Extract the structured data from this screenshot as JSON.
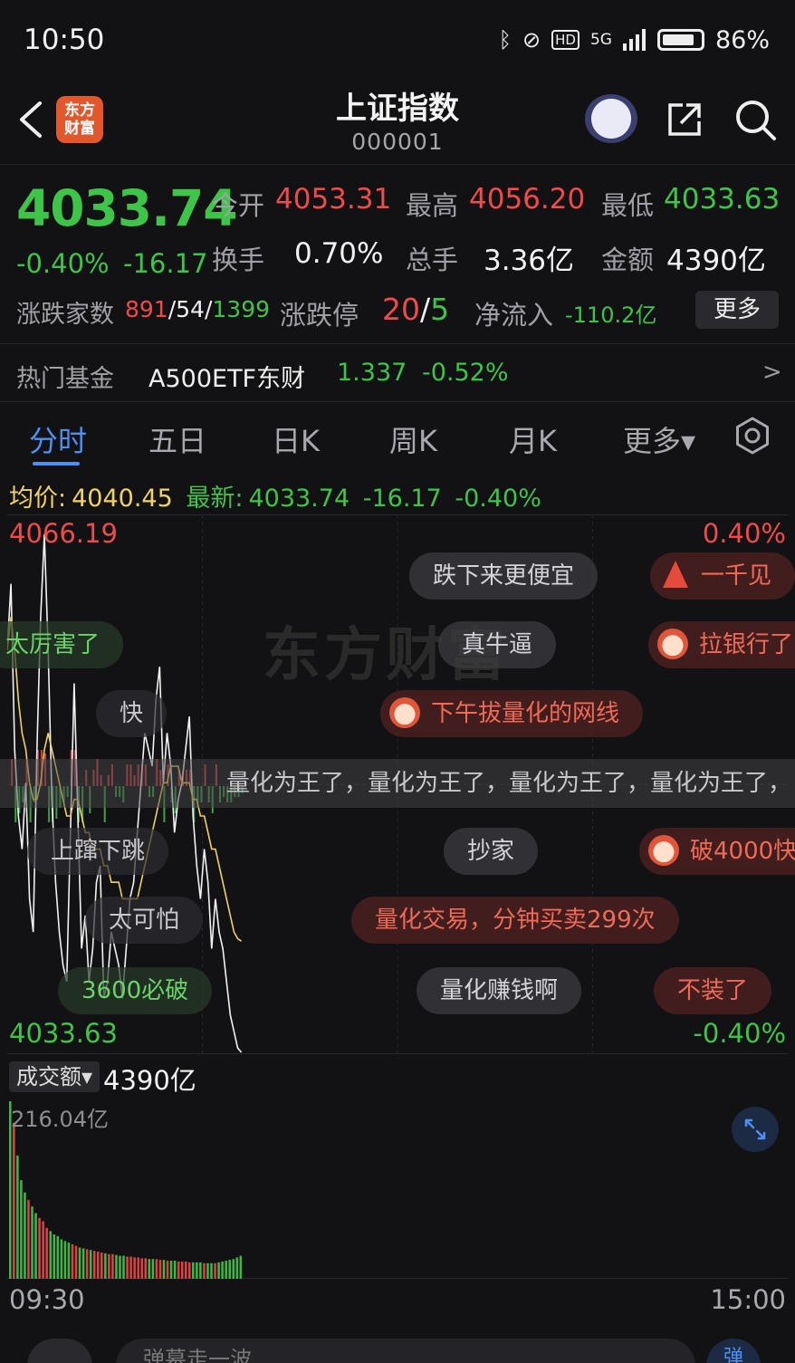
{
  "status_bar": {
    "time": "10:50",
    "battery": "86%",
    "battery_level": 0.86,
    "network": "5G",
    "hd": "HD"
  },
  "header": {
    "title": "上证指数",
    "code": "000001",
    "logo_text_line1": "东方",
    "logo_text_line2": "财富"
  },
  "quote": {
    "price": "4033.74",
    "change_pct": "-0.40%",
    "change_abs": "-16.17",
    "open_label": "今开",
    "open": "4053.31",
    "high_label": "最高",
    "high": "4056.20",
    "low_label": "最低",
    "low": "4033.63",
    "turnover_label": "换手",
    "turnover": "0.70%",
    "volume_label": "总手",
    "volume": "3.36亿",
    "amount_label": "金额",
    "amount": "4390亿",
    "breadth_label": "涨跌家数",
    "breadth_up": "891",
    "breadth_flat": "54",
    "breadth_down": "1399",
    "limit_label": "涨跌停",
    "limit_up": "20",
    "limit_down": "5",
    "netflow_label": "净流入",
    "netflow": "-110.2亿",
    "more_label": "更多"
  },
  "fund": {
    "label": "热门基金",
    "name": "A500ETF东财",
    "price": "1.337",
    "change": "-0.52%",
    "arrow": ">"
  },
  "tabs": [
    {
      "label": "分时",
      "active": true
    },
    {
      "label": "五日"
    },
    {
      "label": "日K"
    },
    {
      "label": "周K"
    },
    {
      "label": "月K"
    },
    {
      "label": "更多▾"
    }
  ],
  "summary": {
    "avg_label": "均价:",
    "avg": "4040.45",
    "latest_label": "最新:",
    "latest": "4033.74",
    "chg": "-16.17",
    "pct": "-0.40%"
  },
  "chart_axes": {
    "high": "4066.19",
    "low": "4033.63",
    "pct_high": "0.40%",
    "pct_low": "-0.40%"
  },
  "watermark": "东方财富",
  "danmaku": [
    {
      "text": "跌下来更便宜",
      "style": "gray"
    },
    {
      "text": "一千见",
      "style": "red"
    },
    {
      "text": "太厉害了",
      "style": "green"
    },
    {
      "text": "真牛逼",
      "style": "gray"
    },
    {
      "text": "拉银行了",
      "style": "red"
    },
    {
      "text": "快",
      "style": "dark"
    },
    {
      "text": "下午拔量化的网线",
      "style": "red"
    },
    {
      "text": "上蹿下跳",
      "style": "dark"
    },
    {
      "text": "抄家",
      "style": "gray"
    },
    {
      "text": "破4000快",
      "style": "red"
    },
    {
      "text": "太可怕",
      "style": "dark"
    },
    {
      "text": "量化交易，分钟买卖299次",
      "style": "red"
    },
    {
      "text": "3600必破",
      "style": "green"
    },
    {
      "text": "量化赚钱啊",
      "style": "gray"
    },
    {
      "text": "不装了",
      "style": "red"
    }
  ],
  "scroll_text": "量化为王了，量化为王了，量化为王了，量化为王了，",
  "volume": {
    "selector": "成交额▾",
    "total": "4390亿",
    "max": "216.04亿"
  },
  "time_axis": {
    "start": "09:30",
    "end": "15:00"
  },
  "bottom": {
    "input_placeholder": "弹幕走一波",
    "send": "弹"
  },
  "colors": {
    "up": "#f04a4a",
    "down": "#3fc44a",
    "accent": "#4f8ff0",
    "avg_line": "#f0d267",
    "bg": "#121214"
  },
  "chart_data": {
    "type": "line",
    "title": "",
    "xlabel": "",
    "ylabel": "",
    "x_range": [
      "09:30",
      "15:00"
    ],
    "ylim": [
      4033.63,
      4066.19
    ],
    "series": [
      {
        "values": [
          4058,
          4062,
          4052,
          4048,
          4046,
          4050,
          4043,
          4041,
          4052,
          4060,
          4065,
          4058,
          4049,
          4044,
          4041,
          4039,
          4038,
          4047,
          4056,
          4048,
          4040,
          4042,
          4038,
          4040,
          4044,
          4045,
          4037,
          4038,
          4041,
          4040,
          4039,
          4037,
          4040,
          4043,
          4044,
          4047,
          4050,
          4053,
          4052,
          4051,
          4055,
          4057,
          4050,
          4053,
          4051,
          4047,
          4049,
          4050,
          4052,
          4054,
          4048,
          4045,
          4043,
          4046,
          4044,
          4040,
          4043,
          4041,
          4040,
          4038,
          4036,
          4035,
          4034,
          4033.74
        ]
      },
      {
        "values": [
          4058,
          4060,
          4058,
          4055,
          4053,
          4052,
          4050,
          4049,
          4049,
          4050,
          4052,
          4053,
          4052,
          4051,
          4050,
          4049,
          4048,
          4048,
          4049,
          4049,
          4048,
          4047,
          4047,
          4046,
          4046,
          4046,
          4045,
          4045,
          4044,
          4044,
          4044,
          4043,
          4043,
          4043,
          4043,
          4043,
          4044,
          4045,
          4046,
          4047,
          4048,
          4049,
          4050,
          4050,
          4051,
          4051,
          4051,
          4050,
          4050,
          4050,
          4049,
          4049,
          4048,
          4048,
          4047,
          4046,
          4046,
          4045,
          4044,
          4043,
          4042,
          4041,
          4040.6,
          4040.45
        ]
      }
    ],
    "volume_values": [
      216,
      190,
      150,
      120,
      105,
      96,
      88,
      80,
      74,
      70,
      62,
      58,
      54,
      52,
      48,
      46,
      44,
      42,
      40,
      38,
      37,
      36,
      35,
      34,
      33,
      32,
      31,
      30,
      30,
      29,
      28,
      28,
      27,
      27,
      26,
      26,
      25,
      25,
      24,
      24,
      24,
      23,
      23,
      22,
      22,
      22,
      21,
      21,
      21,
      20,
      20,
      20,
      20,
      19,
      19,
      19,
      19,
      20,
      21,
      22,
      23,
      24,
      26,
      28
    ],
    "volume_max": 216.04
  }
}
